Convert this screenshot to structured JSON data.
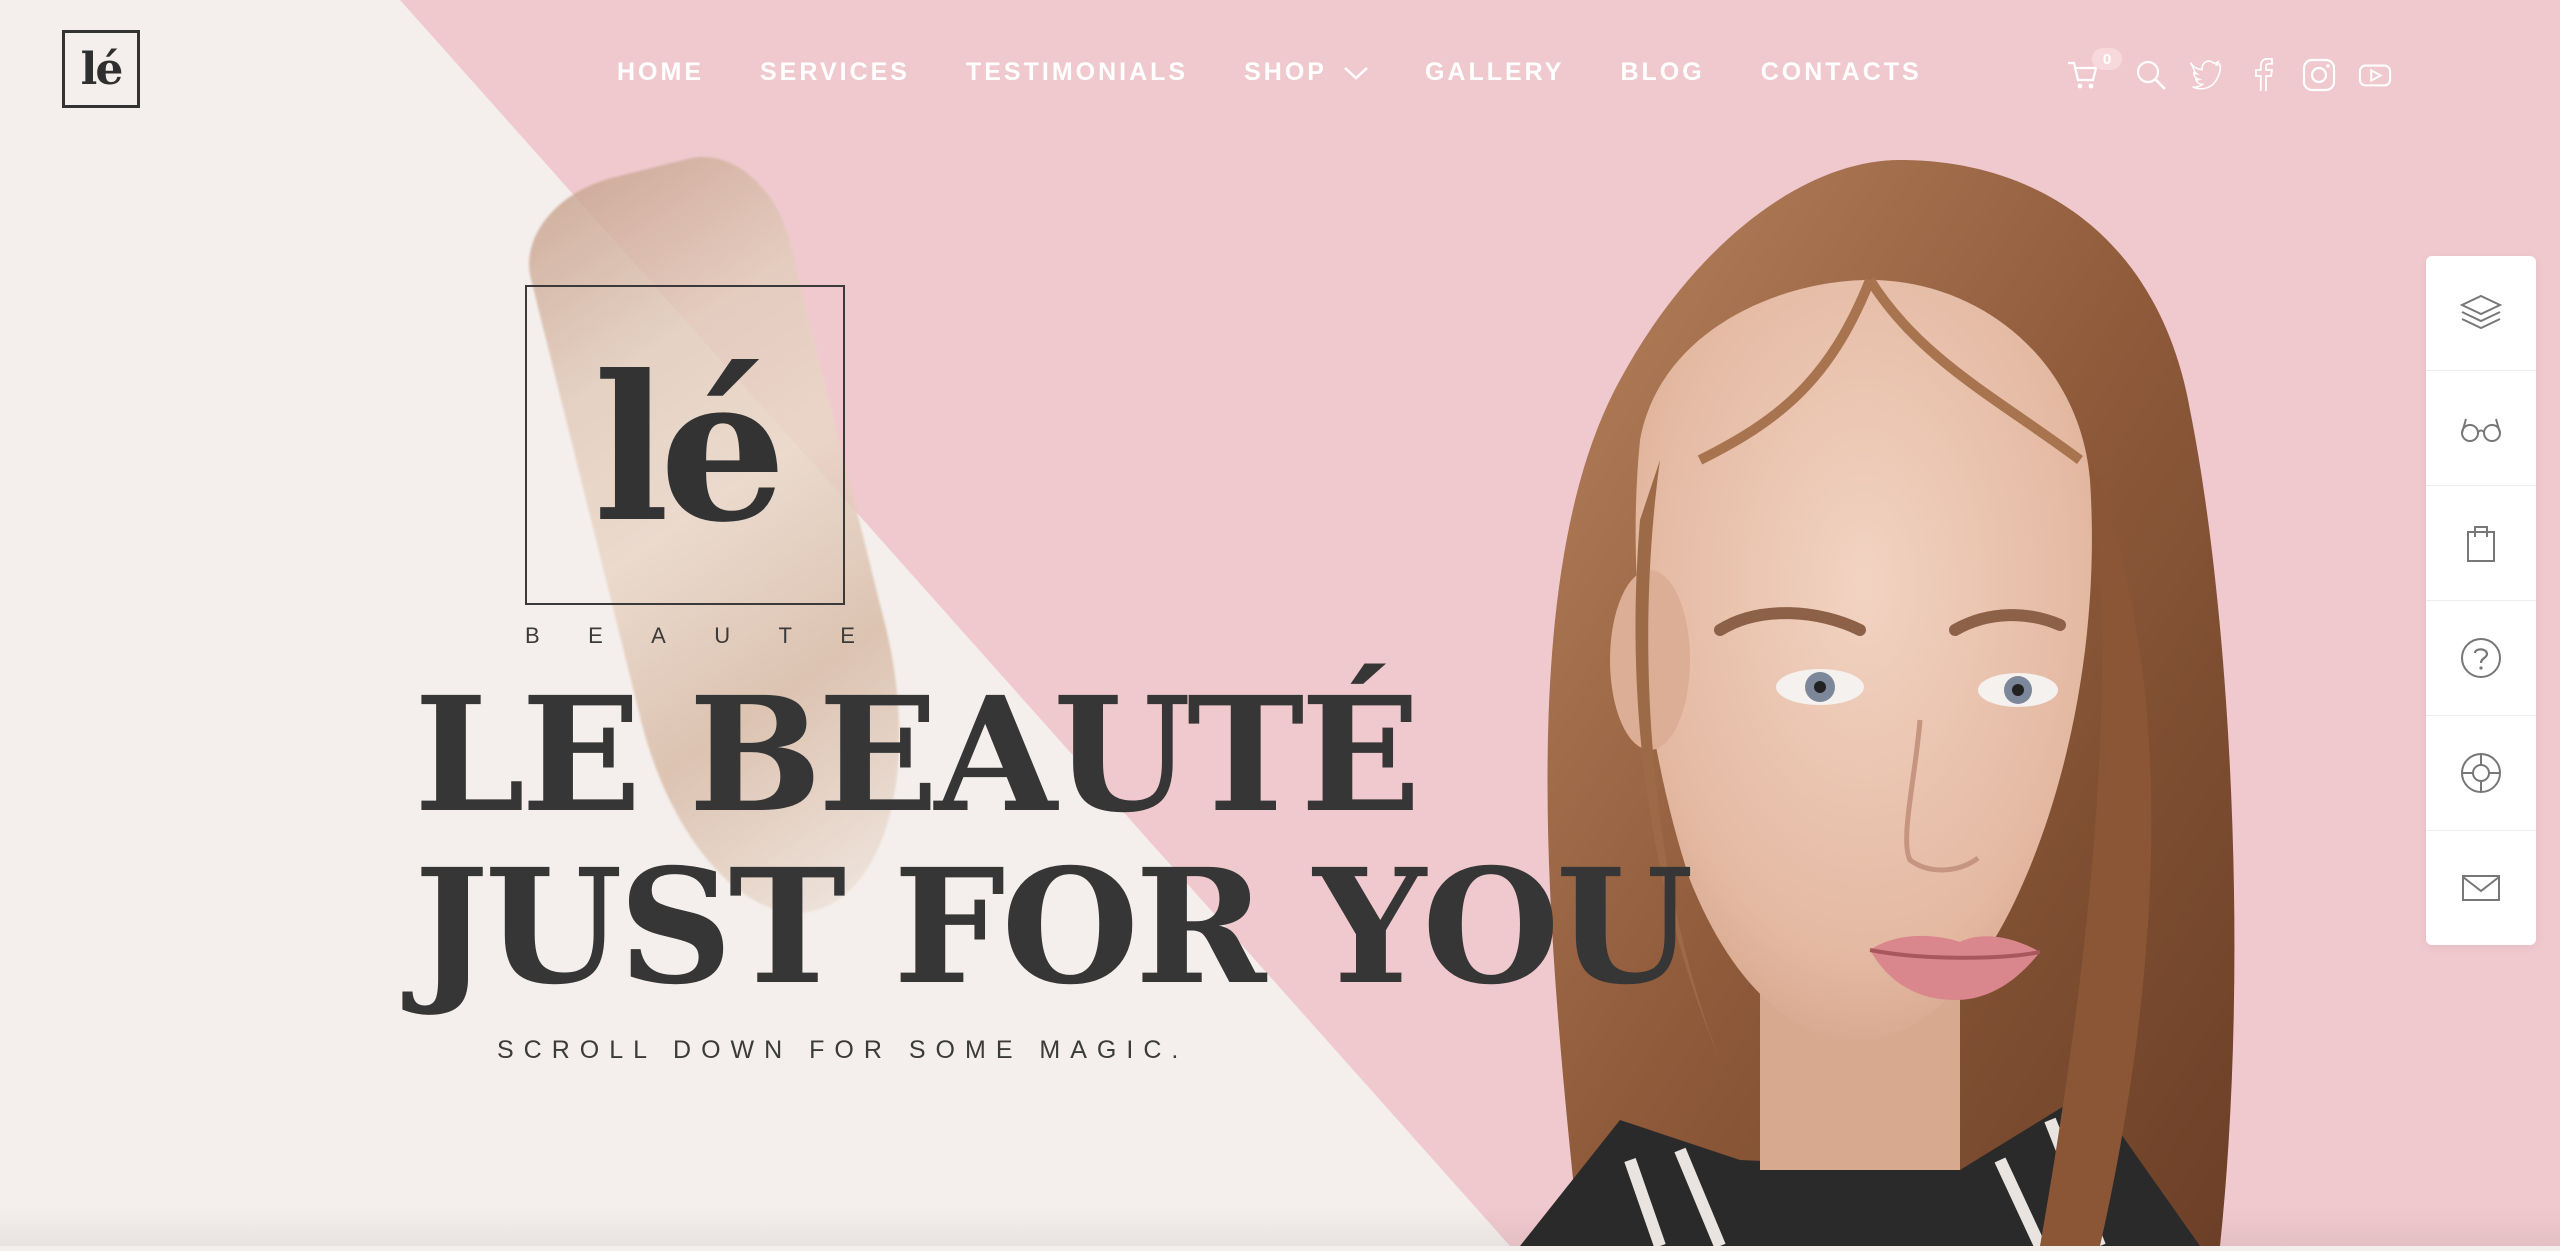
{
  "header": {
    "logo_text": "lé",
    "nav": [
      {
        "label": "HOME"
      },
      {
        "label": "SERVICES"
      },
      {
        "label": "TESTIMONIALS"
      },
      {
        "label": "SHOP"
      },
      {
        "label": "GALLERY"
      },
      {
        "label": "BLOG"
      },
      {
        "label": "CONTACTS"
      }
    ],
    "cart_count": "0",
    "icons": [
      "cart-icon",
      "search-icon",
      "twitter-icon",
      "facebook-icon",
      "instagram-icon",
      "youtube-icon"
    ]
  },
  "hero": {
    "logo_mark": "lé",
    "logo_sub_letters": [
      "B",
      "E",
      "A",
      "U",
      "T",
      "E"
    ],
    "title_line1": "LE BEAUTÉ",
    "title_line2": "JUST FOR YOU",
    "subtitle": "SCROLL DOWN FOR SOME MAGIC."
  },
  "side_panel": {
    "icons": [
      "layers-icon",
      "glasses-icon",
      "shopping-bag-icon",
      "help-icon",
      "support-icon",
      "mail-icon"
    ]
  },
  "colors": {
    "pink_bg": "#f0c9ce",
    "cream_bg": "#f4efec",
    "text_dark": "#363636",
    "nav_text": "#ffffff"
  }
}
